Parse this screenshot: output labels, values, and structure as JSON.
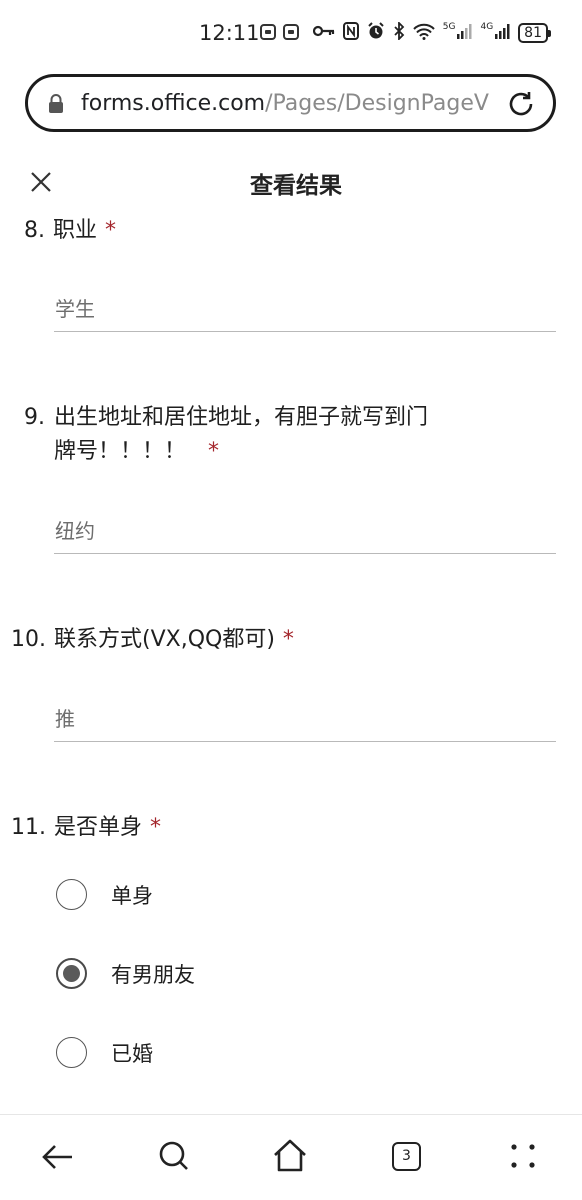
{
  "status_bar": {
    "time": "12:11",
    "network_5g": "5G",
    "network_4g": "4G",
    "battery": "81"
  },
  "browser": {
    "url_domain": "forms.office.com",
    "url_path": "/Pages/DesignPageV",
    "tab_count": "3"
  },
  "header": {
    "title": "查看结果"
  },
  "questions": [
    {
      "number": "8.",
      "title": "职业",
      "required": "*",
      "answer": "学生"
    },
    {
      "number": "9.",
      "title_line1": "出生地址和居住地址，有胆子就写到门",
      "title_line2": "牌号！！！！",
      "required": "*",
      "answer": "纽约"
    },
    {
      "number": "10.",
      "title": "联系方式(VX,QQ都可)",
      "required": "*",
      "answer": "推"
    },
    {
      "number": "11.",
      "title": "是否单身",
      "required": "*",
      "options": [
        {
          "label": "单身",
          "selected": false
        },
        {
          "label": "有男朋友",
          "selected": true
        },
        {
          "label": "已婚",
          "selected": false
        }
      ]
    }
  ],
  "colors": {
    "required": "#a4262c"
  }
}
